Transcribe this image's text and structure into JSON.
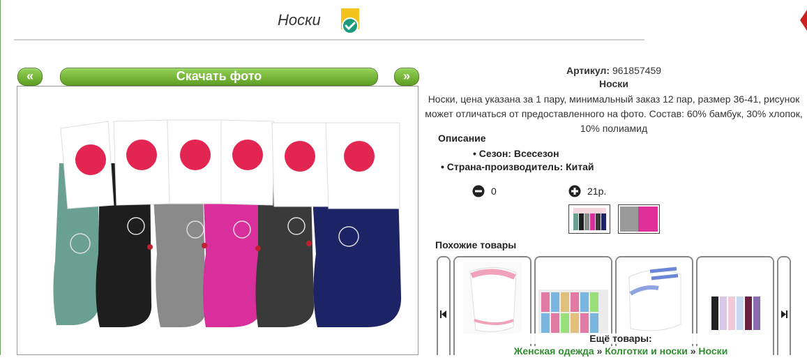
{
  "page": {
    "title": "Носки"
  },
  "gallery": {
    "prev_label": "«",
    "next_label": "»",
    "download_label": "Скачать фото"
  },
  "product": {
    "article_label": "Артикул:",
    "article_value": "961857459",
    "name": "Носки",
    "description": "Носки, цена указана за 1 пару, минимальный заказ 12 пар, размер 36-41, рисунок может отличаться от предоставленного на фото. Состав: 60% бамбук, 30% хлопок, 10% полиамид",
    "details_heading": "Описание",
    "properties": [
      "Сезон: Всесезон",
      "Страна-производитель: Китай"
    ],
    "quantity": "0",
    "price": "21р."
  },
  "similar": {
    "heading": "Похожие товары",
    "more_label": "Ещё товары:",
    "breadcrumbs": [
      "Женская одежда",
      "Колготки и носки",
      "Носки"
    ],
    "breadcrumb_separator": "»"
  },
  "colors": {
    "accent": "#6fb62d",
    "link": "#2f8f2f",
    "badge": "#f3c21d"
  },
  "icons": {
    "verified": "verified-check-icon",
    "minus": "minus-circle-icon",
    "plus": "plus-circle-icon",
    "carousel_prev": "skip-back-icon",
    "carousel_next": "skip-forward-icon"
  }
}
